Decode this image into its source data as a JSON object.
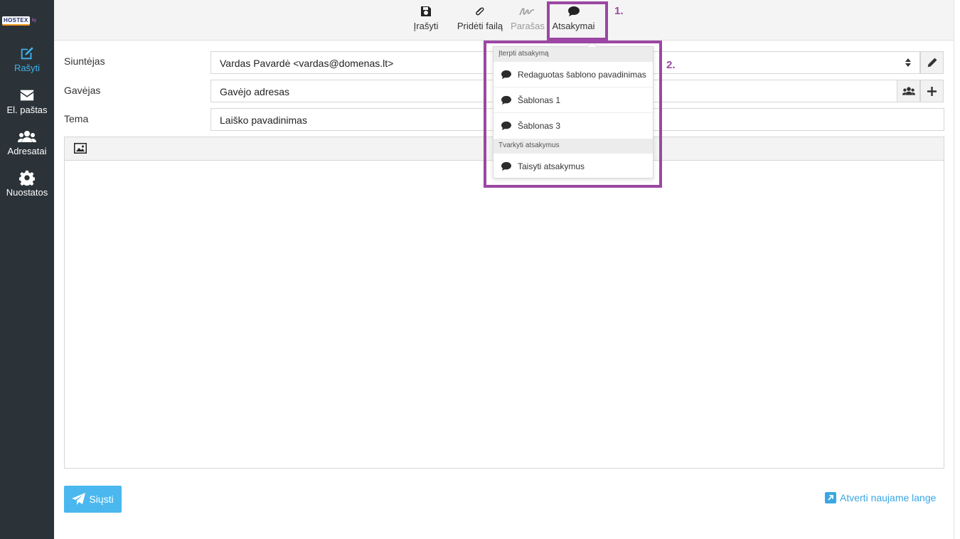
{
  "sidebar": {
    "logo_text": "HOSTEX",
    "logo_sub": "by",
    "items": [
      {
        "label": "Rašyti",
        "icon": "edit-icon"
      },
      {
        "label": "El. paštas",
        "icon": "envelope-icon"
      },
      {
        "label": "Adresatai",
        "icon": "users-icon"
      },
      {
        "label": "Nuostatos",
        "icon": "gear-icon"
      }
    ]
  },
  "toolbar": {
    "save_label": "Įrašyti",
    "attach_label": "Pridėti failą",
    "signature_label": "Parašas",
    "responses_label": "Atsakymai"
  },
  "form": {
    "sender_label": "Siuntėjas",
    "sender_value": "Vardas Pavardė <vardas@domenas.lt>",
    "recipient_label": "Gavėjas",
    "recipient_value": "Gavėjo adresas",
    "subject_label": "Tema",
    "subject_value": "Laiško pavadinimas"
  },
  "footer": {
    "send_label": "Siųsti",
    "open_new_window_label": "Atverti naujame lange"
  },
  "responses_menu": {
    "insert_header": "Įterpti atsakymą",
    "items": [
      {
        "label": "Redaguotas šablono pavadinimas"
      },
      {
        "label": "Šablonas 1"
      },
      {
        "label": "Šablonas 3"
      }
    ],
    "manage_header": "Tvarkyti atsakymus",
    "edit_label": "Taisyti atsakymus"
  },
  "annotations": {
    "marker_1": "1.",
    "marker_2": "2.",
    "color": "#9b47a3"
  },
  "colors": {
    "sidebar_bg": "#2b3338",
    "accent": "#3fb3ec",
    "send_button": "#4ab8ee"
  }
}
